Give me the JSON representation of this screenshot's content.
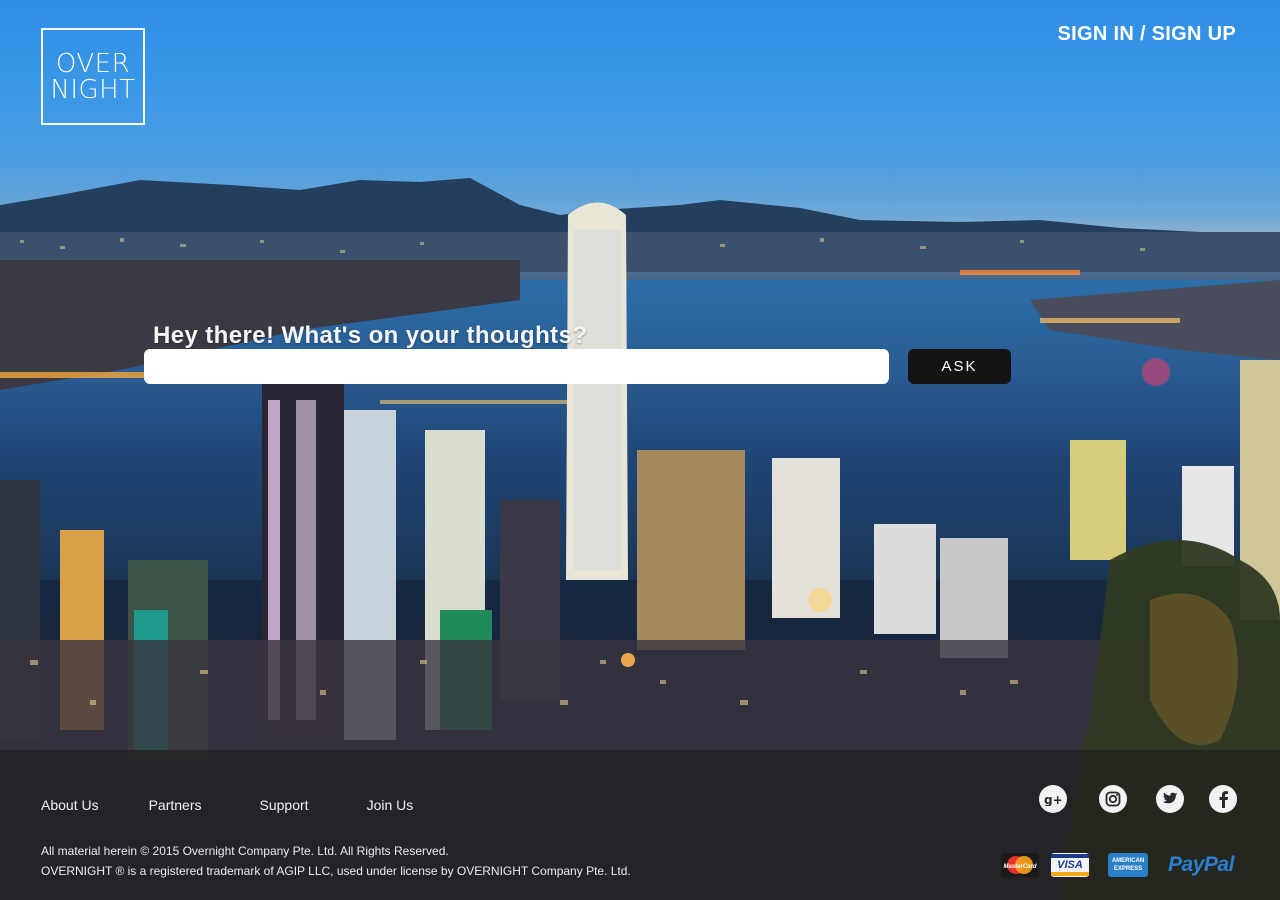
{
  "header": {
    "logo_line1": "OVER",
    "logo_line2": "NIGHT",
    "signin_label": "SIGN IN / SIGN UP"
  },
  "search": {
    "prompt": "Hey there! What's on your thoughts?",
    "value": "",
    "ask_label": "ASK"
  },
  "footer": {
    "links": [
      "About Us",
      "Partners",
      "Support",
      "Join Us"
    ],
    "copyright_line1": "All material herein © 2015 Overnight Company Pte. Ltd. All Rights Reserved.",
    "copyright_line2": "OVERNIGHT ® is a registered trademark of AGIP LLC, used under license by OVERNIGHT Company Pte. Ltd.",
    "social_icons": [
      "google-plus-icon",
      "instagram-icon",
      "twitter-icon",
      "facebook-icon"
    ],
    "payment_methods": {
      "mastercard": "MasterCard",
      "visa": "VISA",
      "amex_line1": "AMERICAN",
      "amex_line2": "EXPRESS",
      "paypal": "PayPal"
    }
  },
  "colors": {
    "ask_button": "#141414",
    "search_bg": "#ffffff",
    "paypal_blue": "#2f7fd1"
  }
}
